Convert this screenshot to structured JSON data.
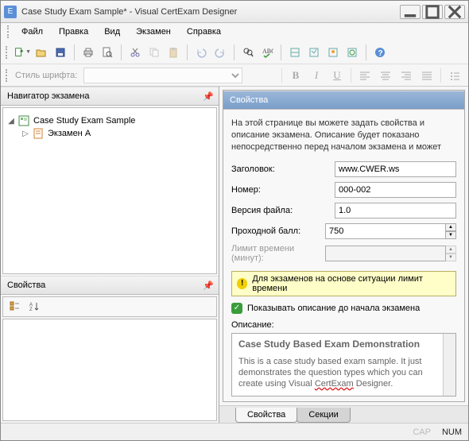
{
  "title": "Case Study Exam Sample* - Visual CertExam Designer",
  "menu": {
    "file": "Файл",
    "edit": "Правка",
    "view": "Вид",
    "exam": "Экзамен",
    "help": "Справка"
  },
  "stylebar": {
    "label": "Стиль шрифта:"
  },
  "navigator": {
    "title": "Навигатор экзамена",
    "root": "Case Study Exam Sample",
    "child1": "Экзамен A"
  },
  "leftProps": {
    "title": "Свойства"
  },
  "rightPanel": {
    "title": "Свойства",
    "intro": "На этой странице вы можете задать свойства и описание экзамена. Описание будет показано непосредственно перед началом экзамена и может",
    "fields": {
      "titleLabel": "Заголовок:",
      "titleValue": "www.CWER.ws",
      "numberLabel": "Номер:",
      "numberValue": "000-002",
      "versionLabel": "Версия файла:",
      "versionValue": "1.0",
      "passLabel": "Проходной балл:",
      "passValue": "750",
      "limitLabel": "Лимит времени (минут):",
      "limitValue": ""
    },
    "info": "Для экзаменов на основе ситуации лимит времени",
    "checkbox": "Показывать описание до начала экзамена",
    "descLabel": "Описание:",
    "desc": {
      "heading": "Case Study Based Exam Demonstration",
      "body1": "This is a case study based exam sample. It just demonstrates the question types which you can create using Visual ",
      "wavy": "CertExam",
      "body2": " Designer."
    }
  },
  "tabs": {
    "props": "Свойства",
    "sections": "Секции"
  },
  "status": {
    "cap": "CAP",
    "num": "NUM"
  }
}
